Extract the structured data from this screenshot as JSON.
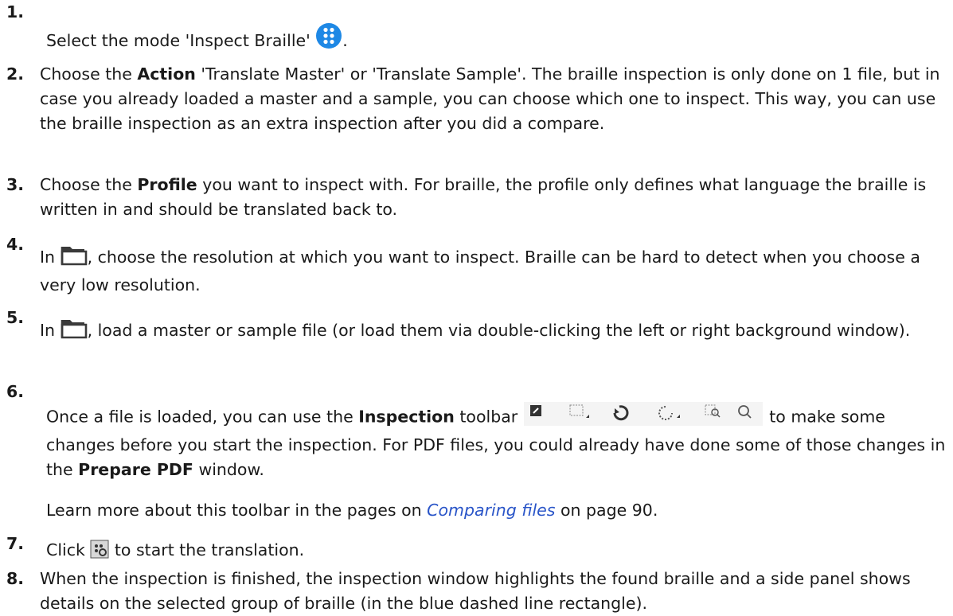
{
  "steps": [
    {
      "num": "1.",
      "parts": {
        "a": "Select the mode 'Inspect Braille' ",
        "b": "."
      }
    },
    {
      "num": "2.",
      "parts": {
        "a": "Choose the ",
        "b": "Action",
        "c": " 'Translate Master' or 'Translate Sample'. The braille inspection is only done on 1 file, but in case you already loaded a master and a sample, you can choose which one to inspect. This way, you can use the braille inspection as an extra inspection after you did a compare."
      }
    },
    {
      "num": "3.",
      "parts": {
        "a": "Choose the ",
        "b": "Profile",
        "c": " you want to inspect with. For braille, the profile only defines what language the braille is written in and should be translated back to."
      }
    },
    {
      "num": "4.",
      "parts": {
        "a": "In ",
        "b": ", choose the resolution at which you want to inspect. Braille can be hard to detect when you choose a very low resolution."
      }
    },
    {
      "num": "5.",
      "parts": {
        "a": "In ",
        "b": ", load a master or sample file (or load them via double-clicking the left or right background window)."
      }
    },
    {
      "num": "6.",
      "parts": {
        "a": "Once a file is loaded, you can use the ",
        "b": "Inspection",
        "c": " toolbar",
        "d": "to make some changes before you start the inspection. For PDF files, you could already have done some of those changes in the ",
        "e": "Prepare PDF",
        "f": " window.",
        "g": "Learn more about this toolbar in the pages on ",
        "link": "Comparing files",
        "h": "  on page 90."
      }
    },
    {
      "num": "7.",
      "parts": {
        "a": "Click ",
        "b": " to start the translation."
      }
    },
    {
      "num": "8.",
      "parts": {
        "a": "When the inspection is finished, the inspection window highlights the found braille and a side panel shows details on the selected group of braille (in the blue dashed line rectangle)."
      }
    }
  ],
  "icons": {
    "braille_mode": "inspect-braille-icon",
    "folder": "folder-icon",
    "toolbar": [
      "crop-icon",
      "select-rectangle-icon",
      "rotate-icon",
      "rotate-free-icon",
      "zoom-area-icon",
      "zoom-icon"
    ],
    "start": "start-translation-icon"
  },
  "colors": {
    "link": "#2a55c8",
    "braille_icon_bg": "#1e88e5",
    "text": "#1a1a1a"
  }
}
